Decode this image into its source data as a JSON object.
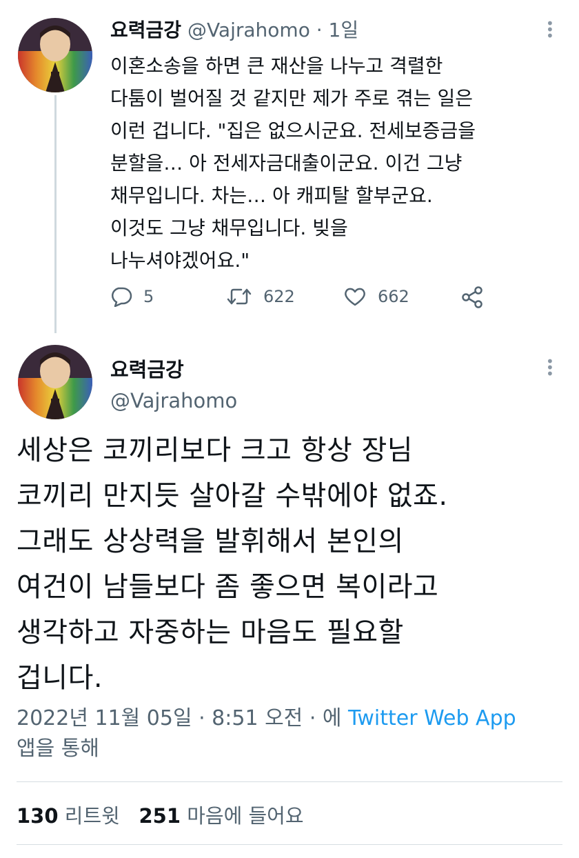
{
  "tweet1": {
    "display_name": "요력금강",
    "handle": "@Vajrahomo",
    "separator": "·",
    "time": "1일",
    "text": "이혼소송을 하면 큰 재산을 나누고 격렬한\n다툼이 벌어질 것 같지만 제가 주로 겪는 일은\n이런 겁니다. \"집은 없으시군요. 전세보증금을\n분할을… 아 전세자금대출이군요. 이건 그냥\n채무입니다. 차는… 아 캐피탈 할부군요.\n이것도 그냥 채무입니다. 빚을\n나누셔야겠어요.\"",
    "replies": "5",
    "retweets": "622",
    "likes": "662"
  },
  "tweet2": {
    "display_name": "요력금강",
    "handle": "@Vajrahomo",
    "text": "세상은 코끼리보다 크고 항상 장님\n코끼리 만지듯 살아갈 수밖에야 없죠.\n그래도 상상력을 발휘해서 본인의\n여건이 남들보다 좀 좋으면 복이라고\n생각하고 자중하는 마음도 필요할\n겁니다.",
    "meta_prefix": "2022년 11월 05일 · 8:51 오전 · 에 ",
    "meta_via": "Twitter Web App",
    "meta_suffix": "앱을 통해",
    "retweet_count": "130",
    "retweet_label": "리트윗",
    "like_count": "251",
    "like_label": "마음에 들어요"
  },
  "colors": {
    "accent": "#1d9bf0",
    "secondary_text": "#536471",
    "primary_text": "#0f1419"
  },
  "icons": [
    "reply-icon",
    "retweet-icon",
    "like-icon",
    "share-icon",
    "more-options-icon"
  ]
}
